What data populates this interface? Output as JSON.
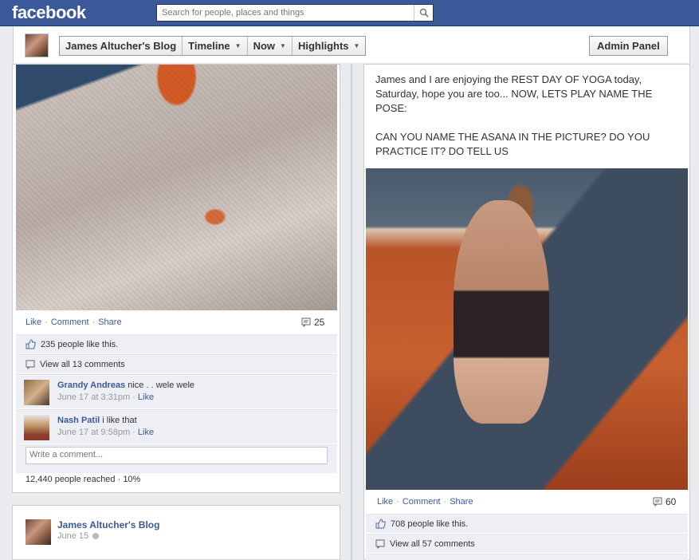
{
  "topbar": {
    "logo": "facebook",
    "search_placeholder": "Search for people, places and things"
  },
  "pagebar": {
    "page_name": "James Altucher's Blog",
    "nav": [
      {
        "label": "Timeline",
        "has_caret": true
      },
      {
        "label": "Now",
        "has_caret": true
      },
      {
        "label": "Highlights",
        "has_caret": true
      }
    ],
    "admin_label": "Admin Panel"
  },
  "left_post": {
    "actions": {
      "like": "Like",
      "comment": "Comment",
      "share": "Share"
    },
    "comment_count": "25",
    "likes_text": "235 people like this.",
    "view_all": "View all 13 comments",
    "comments": [
      {
        "name": "Grandy Andreas",
        "text": "nice . . wele wele",
        "time": "June 17 at 3:31pm",
        "like": "Like"
      },
      {
        "name": "Nash Patil",
        "text": "i like that",
        "time": "June 17 at 9:58pm",
        "like": "Like"
      }
    ],
    "write_placeholder": "Write a comment...",
    "reach": "12,440 people reached · 10%"
  },
  "left_post2": {
    "name": "James Altucher's Blog",
    "date": "June 15"
  },
  "right_post": {
    "text": "James and I are enjoying the REST DAY OF YOGA today, Saturday, hope you are too... NOW, LETS PLAY NAME THE POSE:\n\nCAN YOU NAME THE ASANA IN THE PICTURE? DO YOU PRACTICE IT? DO TELL US",
    "actions": {
      "like": "Like",
      "comment": "Comment",
      "share": "Share"
    },
    "comment_count": "60",
    "likes_text": "708 people like this.",
    "view_all": "View all 57 comments"
  },
  "colors": {
    "brand": "#3b5998",
    "link": "#3b5998",
    "strip_bg": "#edeff4"
  }
}
